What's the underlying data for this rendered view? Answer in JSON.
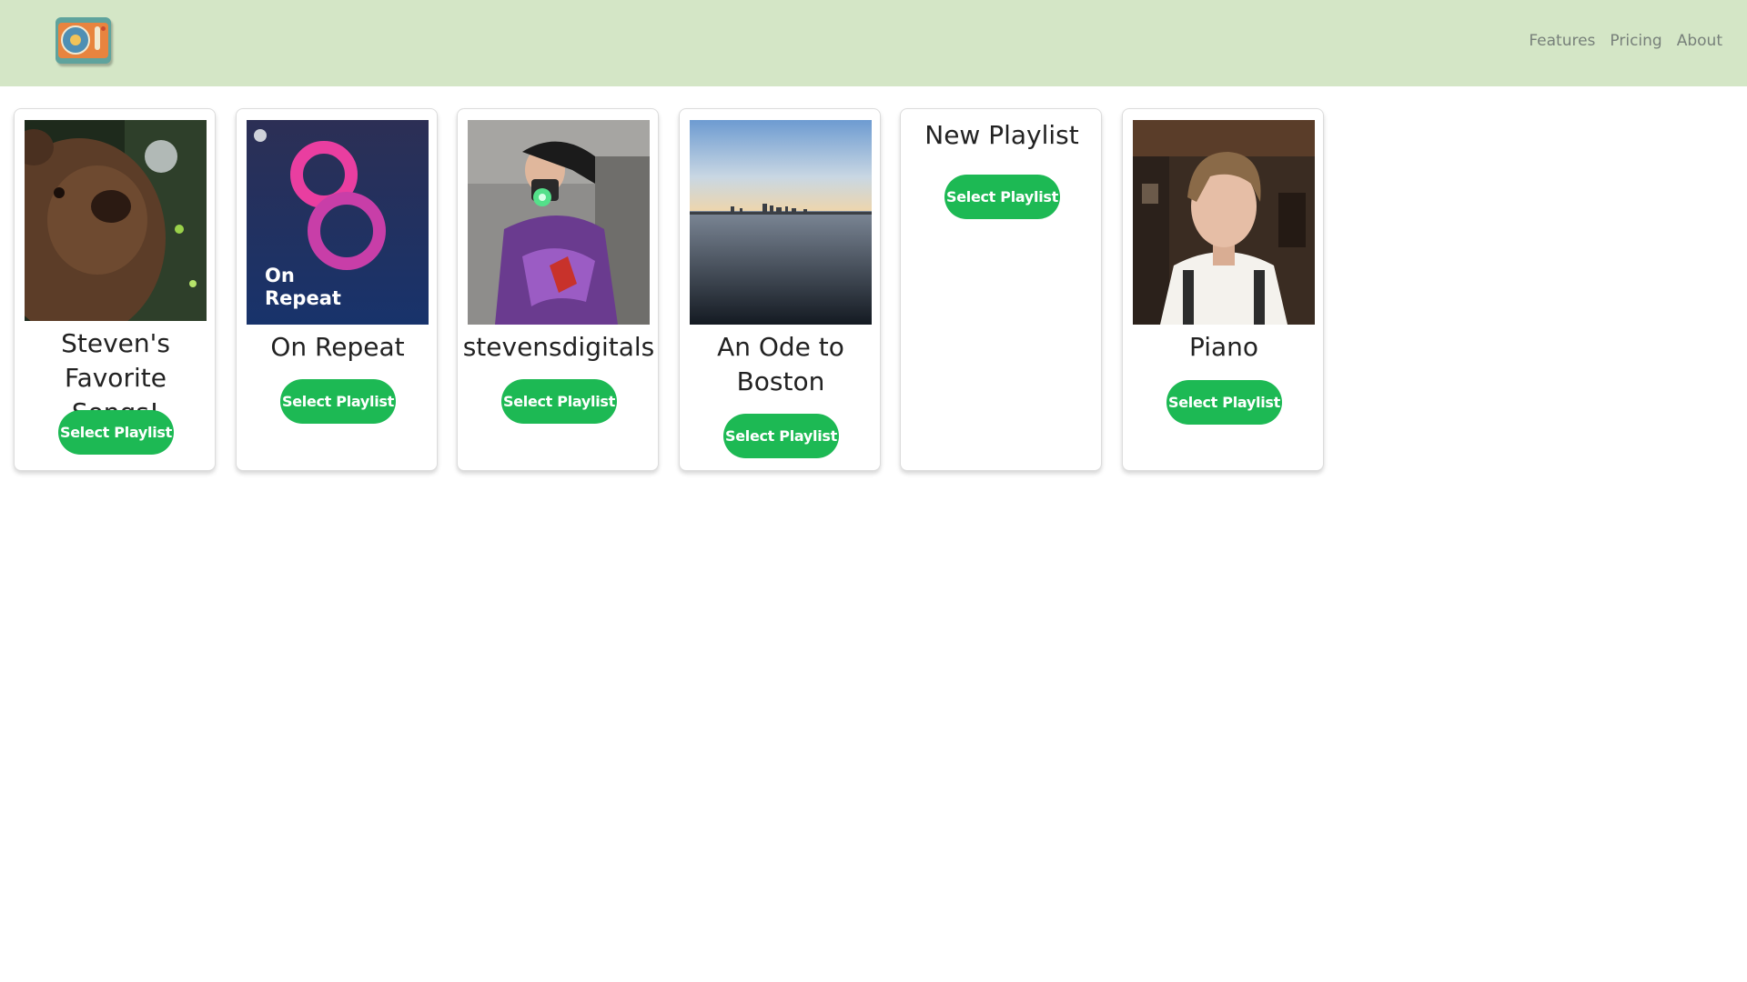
{
  "brand": {
    "logo_icon": "turntable-logo-icon"
  },
  "nav": {
    "links": [
      "Features",
      "Pricing",
      "About"
    ]
  },
  "playlists": [
    {
      "title": "Steven's Favorite Songs!",
      "button": "Select Playlist",
      "image": "teddy-bear-photo"
    },
    {
      "title": "On Repeat",
      "button": "Select Playlist",
      "image": "on-repeat-cover",
      "cover_text": "On Repeat"
    },
    {
      "title": "stevensdigitals",
      "button": "Select Playlist",
      "image": "camera-person-photo"
    },
    {
      "title": "An Ode to Boston",
      "button": "Select Playlist",
      "image": "boston-skyline-photo"
    },
    {
      "title": "New Playlist",
      "button": "Select Playlist",
      "image": null
    },
    {
      "title": "Piano",
      "button": "Select Playlist",
      "image": "portrait-photo"
    }
  ],
  "colors": {
    "navbar": "#d4e6c6",
    "accent": "#1db954",
    "nav_text": "#77807a"
  }
}
